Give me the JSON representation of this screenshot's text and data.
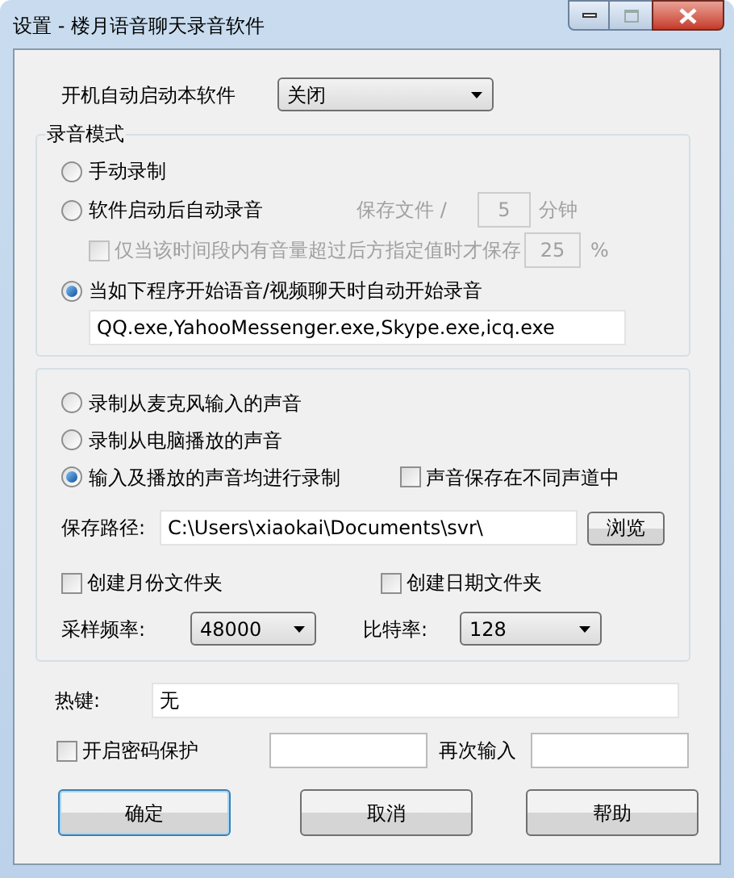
{
  "window": {
    "title": "设置 - 楼月语音聊天录音软件"
  },
  "startup": {
    "label": "开机自动启动本软件",
    "value": "关闭"
  },
  "recording_mode": {
    "legend": "录音模式",
    "options": [
      {
        "kind": "plain",
        "label": "手动录制",
        "selected": false
      },
      {
        "kind": "timed",
        "label": "软件启动后自动录音",
        "selected": false,
        "disabled": true,
        "save_label": "保存文件 /",
        "minutes": "5",
        "unit": "分钟",
        "threshold": {
          "label": "仅当该时间段内有音量超过后方指定值时才保存",
          "checked": false,
          "value": "25",
          "unit": "%"
        }
      },
      {
        "kind": "programs",
        "label": "当如下程序开始语音/视频聊天时自动开始录音",
        "selected": true,
        "programs": "QQ.exe,YahooMessenger.exe,Skype.exe,icq.exe"
      }
    ]
  },
  "source": {
    "options": [
      {
        "label": "录制从麦克风输入的声音",
        "selected": false
      },
      {
        "label": "录制从电脑播放的声音",
        "selected": false
      },
      {
        "label": "输入及播放的声音均进行录制",
        "selected": true
      }
    ],
    "separate_channels": {
      "label": "声音保存在不同声道中",
      "checked": false
    },
    "save_path": {
      "label": "保存路径:",
      "value": "C:\\Users\\xiaokai\\Documents\\svr\\",
      "browse": "浏览"
    },
    "folders": [
      {
        "label": "创建月份文件夹",
        "checked": false
      },
      {
        "label": "创建日期文件夹",
        "checked": false
      }
    ],
    "sample_rate": {
      "label": "采样频率:",
      "value": "48000"
    },
    "bitrate": {
      "label": "比特率:",
      "value": "128"
    }
  },
  "hotkey": {
    "label": "热键:",
    "value": "无"
  },
  "password": {
    "label": "开启密码保护",
    "checked": false,
    "confirm_label": "再次输入"
  },
  "buttons": [
    {
      "label": "确定",
      "focused": true
    },
    {
      "label": "取消",
      "focused": false
    },
    {
      "label": "帮助",
      "focused": false
    }
  ]
}
